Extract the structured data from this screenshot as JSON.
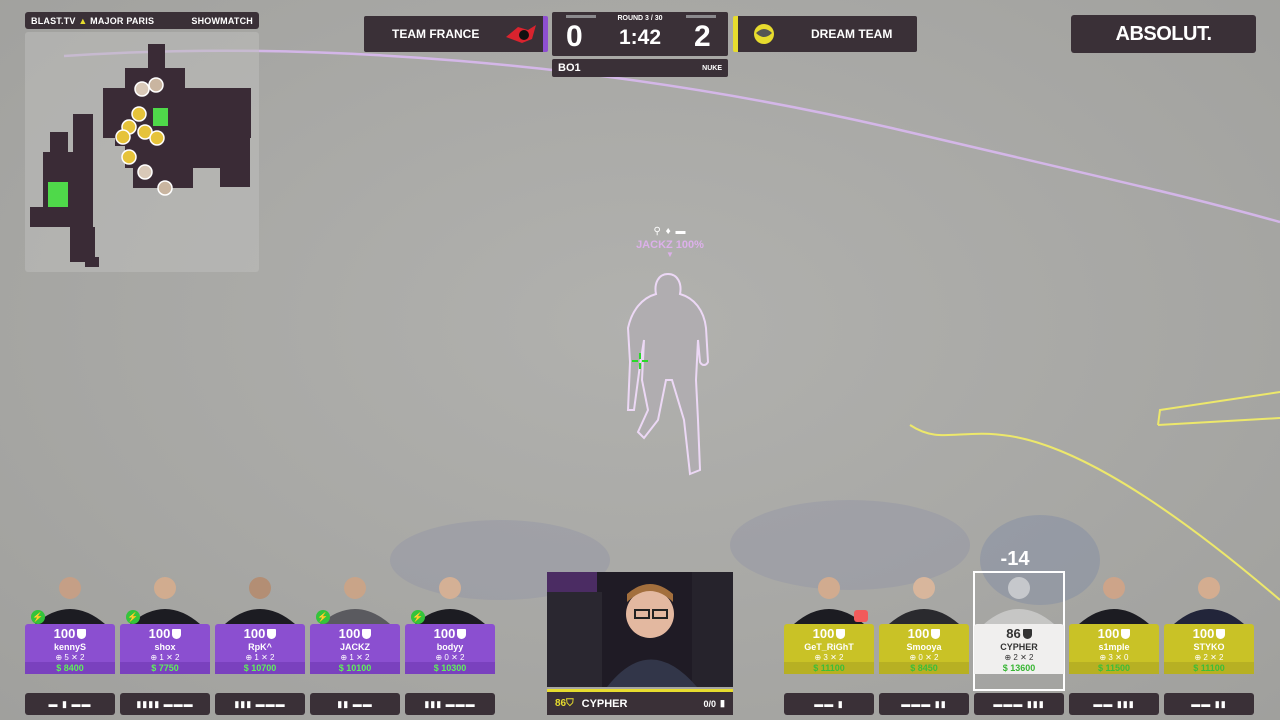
{
  "event": {
    "left": "BLAST.TV",
    "logo_text": "MAJOR PARIS",
    "right": "SHOWMATCH"
  },
  "scoreboard": {
    "left_team": "TEAM FRANCE",
    "right_team": "DREAM TEAM",
    "left_score": "0",
    "right_score": "2",
    "round": "ROUND 3 / 30",
    "clock": "1:42",
    "series": "BO1",
    "map": "NUKE",
    "left_color": "#8e4fd1",
    "right_color": "#e7dc2e"
  },
  "sponsor": {
    "name": "ABSOLUT."
  },
  "target": {
    "label": "JACKZ 100%",
    "icons": "⚲ ♦ ▬"
  },
  "damage_popup": "-14",
  "left_players": [
    {
      "hp": "100",
      "name": "kennyS",
      "kills": "5",
      "deaths": "2",
      "money": "$ 8400",
      "equip": "▬ ▮ ▬▬",
      "defuse": true
    },
    {
      "hp": "100",
      "name": "shox",
      "kills": "1",
      "deaths": "2",
      "money": "$ 7750",
      "equip": "▮▮▮▮ ▬▬▬",
      "defuse": true
    },
    {
      "hp": "100",
      "name": "RpK^",
      "kills": "1",
      "deaths": "2",
      "money": "$ 10700",
      "equip": "▮▮▮ ▬▬▬",
      "defuse": false
    },
    {
      "hp": "100",
      "name": "JACKZ",
      "kills": "1",
      "deaths": "2",
      "money": "$ 10100",
      "equip": "▮▮ ▬▬",
      "defuse": true
    },
    {
      "hp": "100",
      "name": "bodyy",
      "kills": "0",
      "deaths": "2",
      "money": "$ 10300",
      "equip": "▮▮▮ ▬▬▬",
      "defuse": true
    }
  ],
  "right_players": [
    {
      "hp": "100",
      "name": "GeT_RiGhT",
      "kills": "3",
      "deaths": "2",
      "money": "$ 11100",
      "equip": "▬▬ ▮",
      "flag": true
    },
    {
      "hp": "100",
      "name": "Smooya",
      "kills": "0",
      "deaths": "2",
      "money": "$ 8450",
      "equip": "▬▬▬ ▮▮",
      "flag": false
    },
    {
      "hp": "86",
      "name": "CYPHER",
      "kills": "2",
      "deaths": "2",
      "money": "$ 13600",
      "equip": "▬▬▬ ▮▮▮",
      "flag": false
    },
    {
      "hp": "100",
      "name": "s1mple",
      "kills": "3",
      "deaths": "0",
      "money": "$ 11500",
      "equip": "▬▬ ▮▮▮",
      "flag": false
    },
    {
      "hp": "100",
      "name": "STYKO",
      "kills": "2",
      "deaths": "2",
      "money": "$ 11100",
      "equip": "▬▬ ▮▮",
      "flag": false
    }
  ],
  "webcam": {
    "hp": "86",
    "player": "CYPHER",
    "ammo": "0/0"
  }
}
